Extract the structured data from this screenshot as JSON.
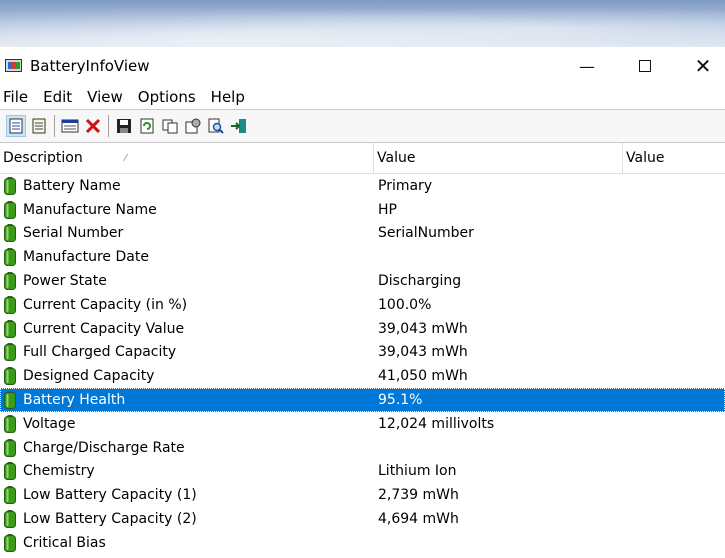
{
  "window": {
    "title": "BatteryInfoView"
  },
  "menu": [
    "File",
    "Edit",
    "View",
    "Options",
    "Help"
  ],
  "toolbar": [
    "properties-icon",
    "html-report-icon",
    "columns-icon",
    "delete-icon",
    "save-icon",
    "refresh-icon",
    "copy-icon",
    "options-icon",
    "find-icon",
    "exit-icon"
  ],
  "columns": [
    "Description",
    "Value",
    "Value"
  ],
  "rows": [
    {
      "desc": "Battery Name",
      "value": "Primary"
    },
    {
      "desc": "Manufacture Name",
      "value": "HP"
    },
    {
      "desc": "Serial Number",
      "value": "SerialNumber"
    },
    {
      "desc": "Manufacture Date",
      "value": ""
    },
    {
      "desc": "Power State",
      "value": "Discharging"
    },
    {
      "desc": "Current Capacity (in %)",
      "value": "100.0%"
    },
    {
      "desc": "Current Capacity Value",
      "value": "39,043 mWh"
    },
    {
      "desc": "Full Charged Capacity",
      "value": "39,043 mWh"
    },
    {
      "desc": "Designed Capacity",
      "value": "41,050 mWh"
    },
    {
      "desc": "Battery Health",
      "value": "95.1%",
      "selected": true
    },
    {
      "desc": "Voltage",
      "value": "12,024 millivolts"
    },
    {
      "desc": "Charge/Discharge Rate",
      "value": ""
    },
    {
      "desc": "Chemistry",
      "value": "Lithium Ion"
    },
    {
      "desc": "Low Battery Capacity (1)",
      "value": "2,739 mWh"
    },
    {
      "desc": "Low Battery Capacity (2)",
      "value": "4,694 mWh"
    },
    {
      "desc": "Critical Bias",
      "value": ""
    }
  ],
  "colors": {
    "selection": "#0078d7",
    "battery_green": "#3a9a1a"
  }
}
